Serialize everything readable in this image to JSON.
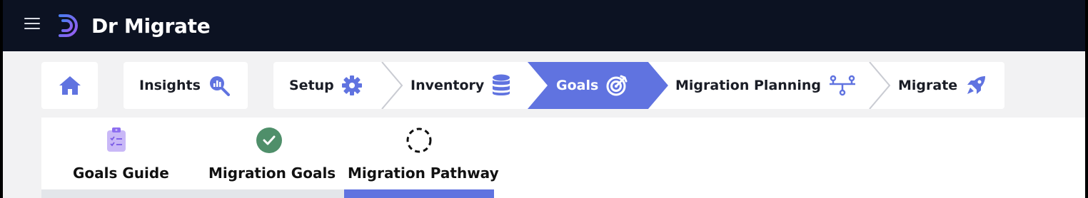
{
  "app": {
    "brand": "Dr Migrate"
  },
  "nav": {
    "home_icon": "home-icon",
    "steps": [
      {
        "label": "Insights",
        "icon": "insights-magnifier-chart-icon"
      },
      {
        "label": "Setup",
        "icon": "gear-icon"
      },
      {
        "label": "Inventory",
        "icon": "database-icon"
      },
      {
        "label": "Goals",
        "icon": "target-arrow-icon",
        "active": true
      },
      {
        "label": "Migration Planning",
        "icon": "network-nodes-icon"
      },
      {
        "label": "Migrate",
        "icon": "rocket-icon"
      }
    ]
  },
  "subtabs": [
    {
      "label": "Goals Guide",
      "icon": "clipboard-checklist-icon",
      "status": "visited"
    },
    {
      "label": "Migration Goals",
      "icon": "check-circle-icon",
      "status": "complete"
    },
    {
      "label": "Migration Pathway",
      "icon": "dashed-circle-icon",
      "status": "active"
    }
  ],
  "colors": {
    "topbar": "#0c1222",
    "accent": "#6073e0",
    "success": "#4f8f6a",
    "page_bg": "#f2f2f3"
  }
}
